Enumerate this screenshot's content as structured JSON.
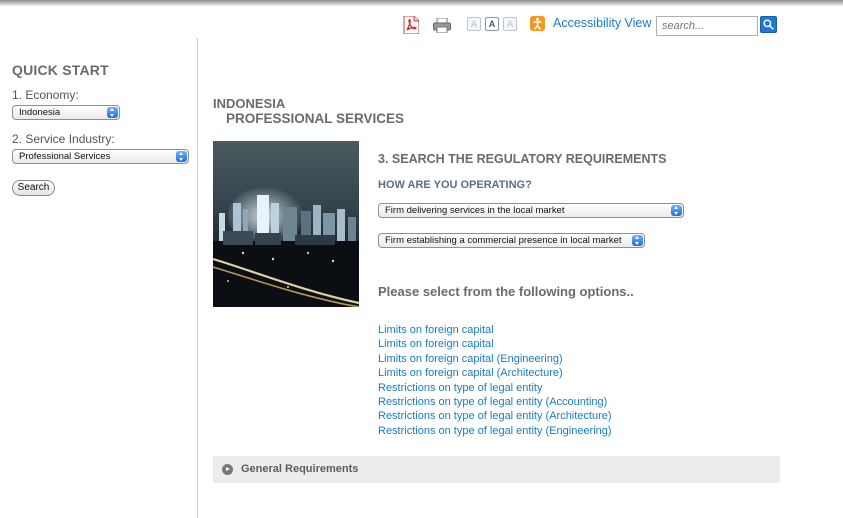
{
  "toolbar": {
    "icons": [
      "pdf-icon",
      "print-icon",
      "font-decrease-icon",
      "font-normal-icon",
      "font-increase-icon",
      "accessibility-icon",
      "search-go-icon"
    ],
    "font_size_glyphs": [
      "A",
      "A",
      "A"
    ],
    "accessibility_label": "Accessibility View",
    "search_placeholder": "search..."
  },
  "sidebar": {
    "title": "QUICK START",
    "economy_label": "1. Economy:",
    "economy_value": "Indonesia",
    "industry_label": "2. Service Industry:",
    "industry_value": "Professional Services",
    "search_label": "Search"
  },
  "main": {
    "heading_line1": "INDONESIA",
    "heading_line2": "PROFESSIONAL SERVICES",
    "step_title": "3. SEARCH THE REGULATORY REQUIREMENTS",
    "operating_question": "HOW ARE YOU OPERATING?",
    "operating_select_1": "Firm delivering services in the local market",
    "operating_select_2": "Firm establishing a commercial presence in local market",
    "options_title": "Please select from the following options..",
    "options": [
      "Limits on foreign capital",
      "Limits on foreign capital",
      "Limits on foreign capital (Engineering)",
      "Limits on foreign capital (Architecture)",
      "Restrictions on type of legal entity",
      "Restrictions on type of legal entity (Accounting)",
      "Restrictions on type of legal entity (Architecture)",
      "Restrictions on type of legal entity (Engineering)"
    ],
    "general_section_label": "General Requirements"
  },
  "colors": {
    "link": "#1a7cc7",
    "heading": "#6b6b6b",
    "search_button": "#1f7ad6",
    "rss_orange": "#f29a1f"
  }
}
